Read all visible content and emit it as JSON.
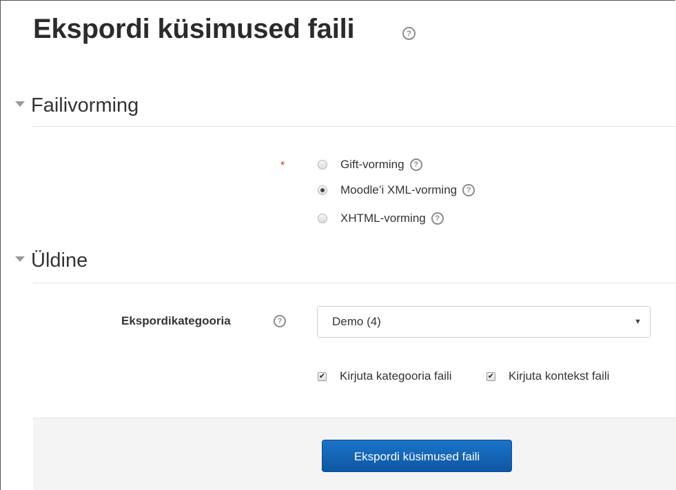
{
  "page": {
    "title": "Ekspordi küsimused faili",
    "help_glyph": "?"
  },
  "sections": {
    "file_format": {
      "header": "Failivorming",
      "required_mark": "*",
      "options": [
        {
          "label": "Gift-vorming",
          "selected": false
        },
        {
          "label": "Moodle’i XML-vorming",
          "selected": true
        },
        {
          "label": "XHTML-vorming",
          "selected": false
        }
      ]
    },
    "general": {
      "header": "Üldine",
      "category_label": "Ekspordikategooria",
      "category_value": "Demo (4)",
      "caret": "▼",
      "checkboxes": [
        {
          "label": "Kirjuta kategooria faili",
          "checked": true
        },
        {
          "label": "Kirjuta kontekst faili",
          "checked": true
        }
      ]
    }
  },
  "actions": {
    "submit_label": "Ekspordi küsimused faili"
  },
  "colors": {
    "button": "#1566b8",
    "required": "#c0392b",
    "footer_bg": "#f4f4f4"
  }
}
